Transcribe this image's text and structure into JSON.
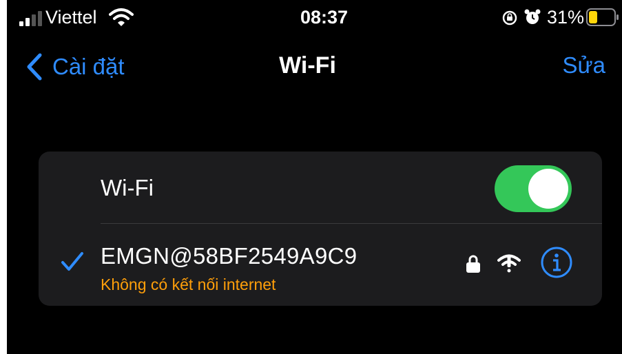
{
  "status_bar": {
    "carrier": "Viettel",
    "time": "08:37",
    "battery_percent": "31%",
    "icons": [
      "signal-icon",
      "wifi-icon",
      "rotation-lock-icon",
      "alarm-icon",
      "battery-icon"
    ]
  },
  "nav": {
    "back_label": "Cài đặt",
    "title": "Wi-Fi",
    "edit_label": "Sửa"
  },
  "wifi_section": {
    "toggle_label": "Wi-Fi",
    "toggle_on": true,
    "network": {
      "name": "EMGN@58BF2549A9C9",
      "status": "Không có kết nối internet",
      "connected": true,
      "secured": true
    }
  },
  "colors": {
    "accent": "#2f8cff",
    "toggle_on": "#34c759",
    "warning": "#ff9f0a",
    "card_bg": "#1c1c1e"
  }
}
